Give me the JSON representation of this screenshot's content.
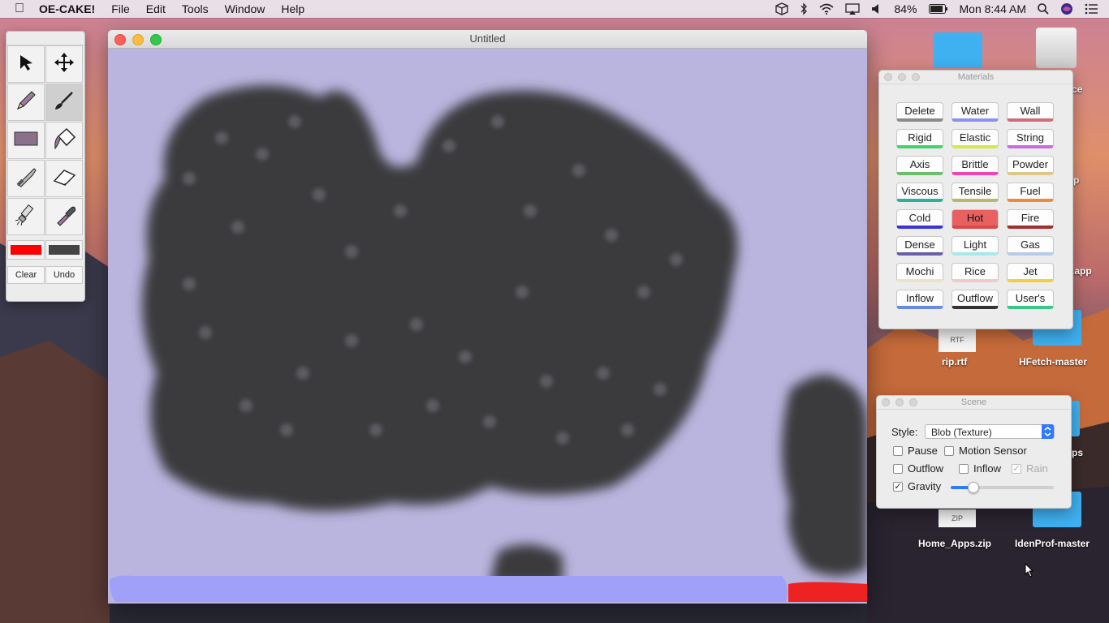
{
  "menubar": {
    "app_name": "OE-CAKE!",
    "menus": [
      "File",
      "Edit",
      "Tools",
      "Window",
      "Help"
    ],
    "battery": "84%",
    "clock": "Mon 8:44 AM"
  },
  "palette": {
    "tools": [
      "select-arrow-icon",
      "move-icon",
      "pencil-icon",
      "brush-icon",
      "rectangle-icon",
      "paint-bucket-icon",
      "knife-icon",
      "eraser-icon",
      "flashlight-icon",
      "dropper-icon"
    ],
    "active_tool": "brush-icon",
    "primary_color": "#ff0000",
    "secondary_color": "#444444",
    "clear_label": "Clear",
    "undo_label": "Undo"
  },
  "window": {
    "title": "Untitled"
  },
  "materials": {
    "title": "Materials",
    "items": [
      {
        "label": "Delete",
        "color": "#8a8a8a"
      },
      {
        "label": "Water",
        "color": "#8f8ff0"
      },
      {
        "label": "Wall",
        "color": "#cc6e78"
      },
      {
        "label": "Rigid",
        "color": "#41d46a"
      },
      {
        "label": "Elastic",
        "color": "#d8e84a"
      },
      {
        "label": "String",
        "color": "#c86de0"
      },
      {
        "label": "Axis",
        "color": "#6bbf6b"
      },
      {
        "label": "Brittle",
        "color": "#f043b6"
      },
      {
        "label": "Powder",
        "color": "#dcc98a"
      },
      {
        "label": "Viscous",
        "color": "#2ab0a0"
      },
      {
        "label": "Tensile",
        "color": "#b8b86a"
      },
      {
        "label": "Fuel",
        "color": "#ee8a3a"
      },
      {
        "label": "Cold",
        "color": "#3a34d8"
      },
      {
        "label": "Hot",
        "color": "#d84a4a"
      },
      {
        "label": "Fire",
        "color": "#a03030"
      },
      {
        "label": "Dense",
        "color": "#6a60a8"
      },
      {
        "label": "Light",
        "color": "#a8e8e8"
      },
      {
        "label": "Gas",
        "color": "#b8cce8"
      },
      {
        "label": "Mochi",
        "color": "#efe0c8"
      },
      {
        "label": "Rice",
        "color": "#f4c8c8"
      },
      {
        "label": "Jet",
        "color": "#f0d040"
      },
      {
        "label": "Inflow",
        "color": "#6a8ae0"
      },
      {
        "label": "Outflow",
        "color": "#333333"
      },
      {
        "label": "User's",
        "color": "#3ac88a"
      }
    ],
    "selected": "Hot"
  },
  "scene": {
    "title": "Scene",
    "style_label": "Style:",
    "style_value": "Blob (Texture)",
    "pause_label": "Pause",
    "motion_sensor_label": "Motion Sensor",
    "outflow_label": "Outflow",
    "inflow_label": "Inflow",
    "rain_label": "Rain",
    "gravity_label": "Gravity",
    "gravity_level": 0.22
  },
  "desktop": {
    "items": [
      {
        "label": "rip.rtf",
        "badge": "RTF"
      },
      {
        "label": "HFetch-master"
      },
      {
        "label": "Home_Apps.zip",
        "badge": "ZIP"
      },
      {
        "label": "IdenProf-master"
      },
      {
        "label": ".app"
      },
      {
        "label": "ps"
      },
      {
        "label": "ce"
      },
      {
        "label": "p"
      }
    ]
  }
}
